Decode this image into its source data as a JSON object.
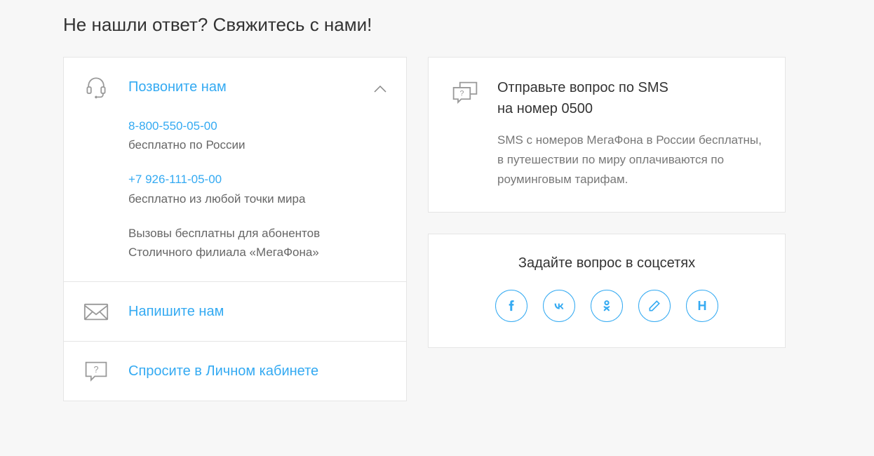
{
  "page": {
    "title": "Не нашли ответ? Свяжитесь с нами!"
  },
  "accordion": {
    "call": {
      "title": "Позвоните нам",
      "phone1": "8-800-550-05-00",
      "phone1_note": "бесплатно по России",
      "phone2": "+7 926-111-05-00",
      "phone2_note": "бесплатно из любой точки мира",
      "footnote": "Вызовы бесплатны для абонентов Столичного филиала «МегаФона»"
    },
    "write": {
      "title": "Напишите нам"
    },
    "ask": {
      "title": "Спросите в Личном кабинете"
    }
  },
  "sms": {
    "title_line1": "Отправьте вопрос по SMS",
    "title_line2": "на номер 0500",
    "desc": "SMS с номеров МегаФона в России бесплатны, в путешествии по миру оплачиваются по роуминговым тарифам."
  },
  "social": {
    "title": "Задайте вопрос в соцсетях",
    "habr_label": "H"
  }
}
